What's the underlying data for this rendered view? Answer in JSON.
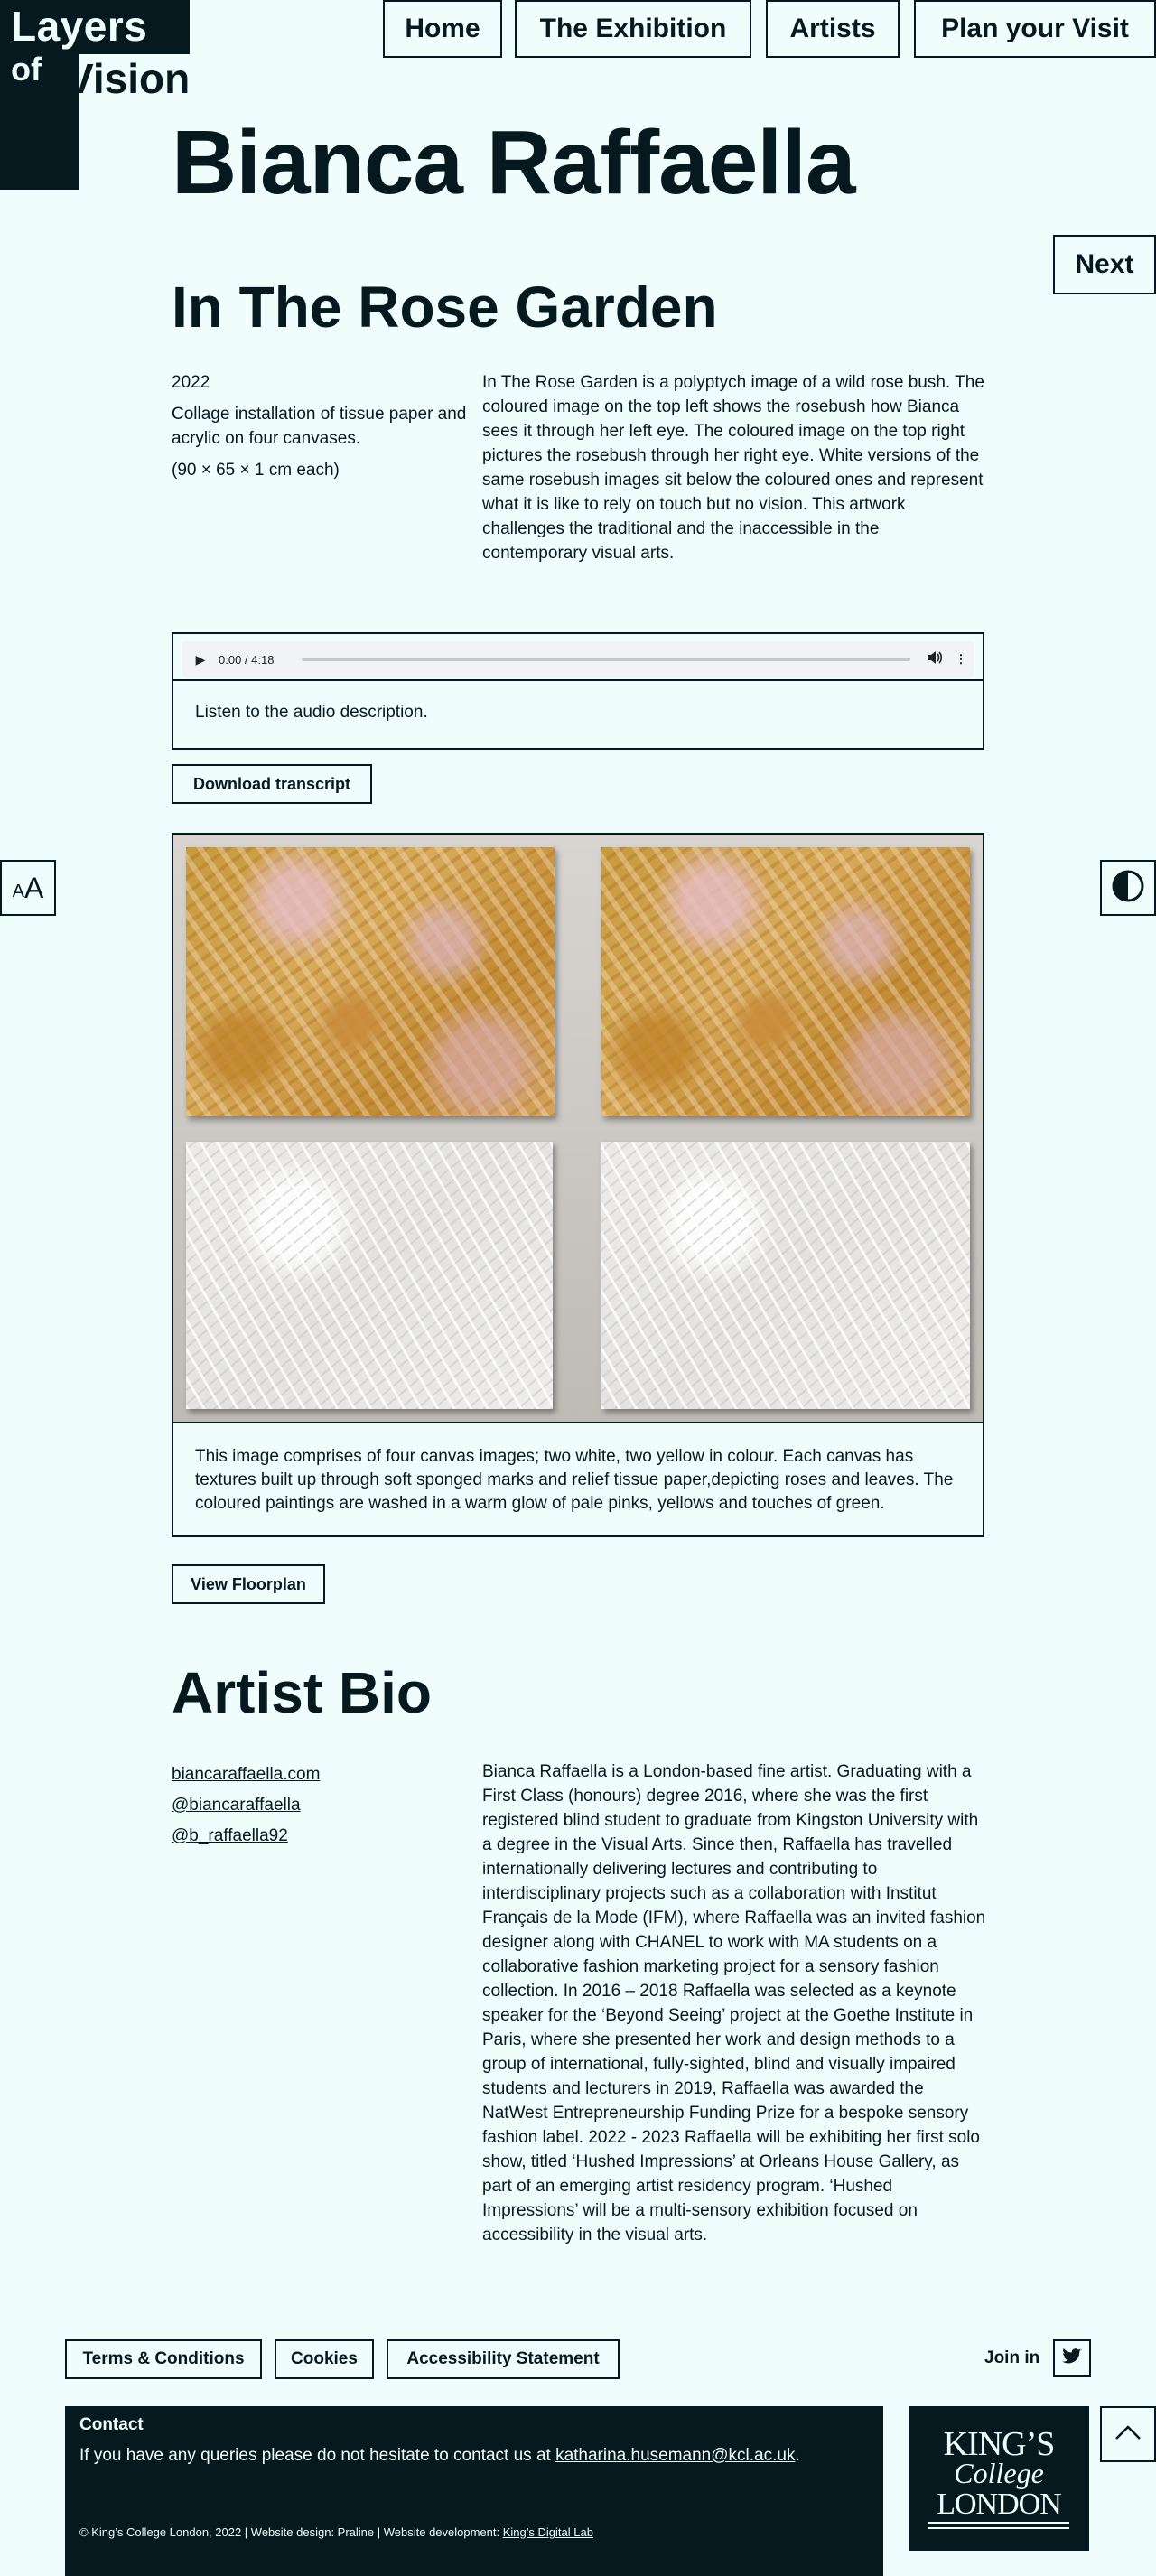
{
  "logo": {
    "line1": "Layers",
    "line2": "of",
    "line3": "Vision"
  },
  "nav": {
    "items": [
      {
        "label": "Home"
      },
      {
        "label": "The Exhibition"
      },
      {
        "label": "Artists"
      },
      {
        "label": "Plan your Visit"
      }
    ]
  },
  "artist": {
    "name": "Bianca Raffaella"
  },
  "next_label": "Next",
  "artwork": {
    "title": "In The Rose Garden",
    "year": "2022",
    "medium": "Collage installation of tissue paper and acrylic on four canvases.",
    "dimensions": "(90 × 65 × 1 cm each)",
    "description": "In The Rose Garden is a polyptych image of a wild rose bush. The coloured image on the top left shows the rosebush how Bianca sees it through her left eye. The coloured image on the top right pictures the rosebush through her right eye. White versions of the same rosebush images sit below the coloured ones and represent what it is like to rely on touch but no vision. This artwork challenges the traditional and the inaccessible in the contemporary visual arts."
  },
  "audio": {
    "time": "0:00 / 4:18",
    "caption": "Listen to the audio description."
  },
  "download_transcript_label": "Download transcript",
  "image": {
    "caption": "This image comprises of four canvas images; two white, two yellow in colour. Each canvas has textures built up through soft sponged marks and relief tissue paper,depicting roses and leaves. The coloured paintings are washed in a warm glow of pale pinks, yellows and touches of green."
  },
  "view_floorplan_label": "View Floorplan",
  "bio": {
    "heading": "Artist Bio",
    "links": [
      "biancaraffaella.com",
      "@biancaraffaella",
      "@b_raffaella92"
    ],
    "text": "Bianca Raffaella is a London-based fine artist. Graduating with a First Class (honours) degree 2016, where she was the first registered blind student to graduate from Kingston University with a degree in the Visual Arts. Since then, Raffaella has travelled internationally delivering lectures and contributing to interdisciplinary projects such as a collaboration with Institut Français de la Mode (IFM), where Raffaella was an invited fashion designer along with CHANEL to work with MA students on a collaborative fashion marketing project for a sensory fashion collection. In 2016 – 2018 Raffaella was selected as a keynote speaker for the ‘Beyond Seeing’ project at the Goethe Institute in Paris, where she presented her work and design methods to a group of international, fully-sighted, blind and visually impaired students and lecturers in 2019, Raffaella was awarded the NatWest Entrepreneurship Funding Prize for a bespoke sensory fashion label. 2022 - 2023 Raffaella will be exhibiting her first solo show, titled ‘Hushed Impressions’ at Orleans House Gallery, as part of an emerging artist residency program. ‘Hushed Impressions’ will be a multi-sensory exhibition focused on accessibility in the visual arts."
  },
  "tools": {
    "text_size_small": "A",
    "text_size_large": "A"
  },
  "footer": {
    "links": [
      "Terms & Conditions",
      "Cookies",
      "Accessibility Statement"
    ],
    "join_label": "Join in",
    "contact_title": "Contact",
    "contact_text": "If you have any queries please do not hesitate to contact us at ",
    "contact_email": "katharina.husemann@kcl.ac.uk",
    "contact_end": ".",
    "copyright_text": "© King’s College London, 2022 | Website design: Praline | Website development: ",
    "copyright_link": "King’s Digital Lab",
    "kcl_line1": "KING’S",
    "kcl_line2": "College",
    "kcl_line3": "LONDON"
  },
  "colors": {
    "background": "#effdfd",
    "ink": "#06191f",
    "audio_bg": "#f1f3f4"
  },
  "icons": [
    "contrast-icon",
    "twitter-icon",
    "chevron-up-icon",
    "play-icon",
    "volume-icon",
    "more-icon"
  ]
}
